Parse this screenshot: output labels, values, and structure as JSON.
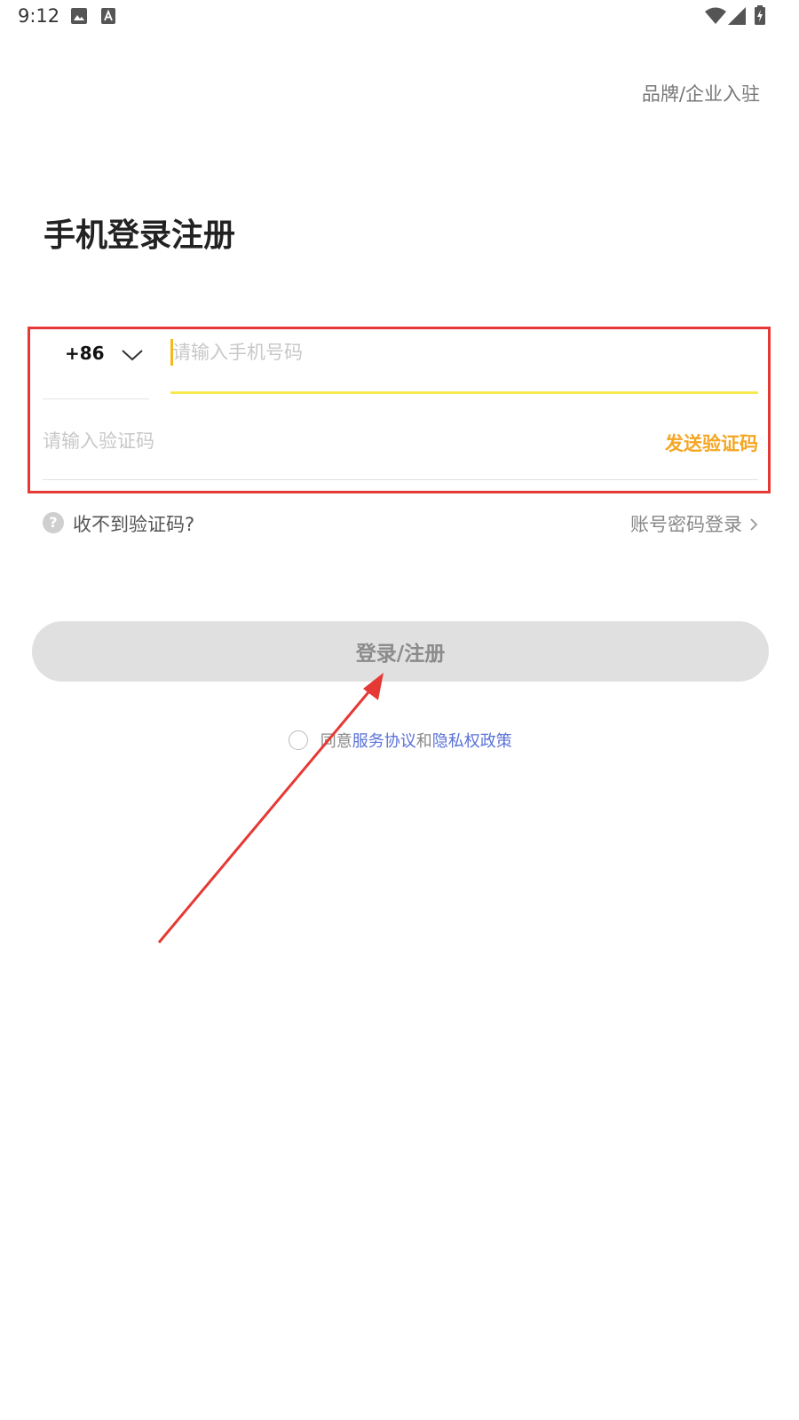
{
  "status_bar": {
    "time": "9:12",
    "left_icons": [
      "image-icon",
      "font-a-icon"
    ],
    "right_icons": [
      "wifi-icon",
      "signal-icon",
      "battery-charging-icon"
    ]
  },
  "header": {
    "brand_link": "品牌/企业入驻"
  },
  "login_form": {
    "title": "手机登录注册",
    "country_code": "+86",
    "phone_placeholder": "请输入手机号码",
    "phone_value": "",
    "code_placeholder": "请输入验证码",
    "code_value": "",
    "send_code_label": "发送验证码",
    "help_text": "收不到验证码?",
    "account_login_label": "账号密码登录",
    "submit_label": "登录/注册"
  },
  "agreement": {
    "prefix": "同意",
    "service_link": "服务协议",
    "joiner": "和",
    "privacy_link": "隐私权政策",
    "checked": false
  },
  "colors": {
    "accent_yellow": "#f7e84e",
    "cursor": "#f4b81c",
    "send_code": "#f5a623",
    "link_blue": "#5a72d8",
    "annotation_red": "#e53935",
    "button_disabled": "#e0e0e0"
  }
}
